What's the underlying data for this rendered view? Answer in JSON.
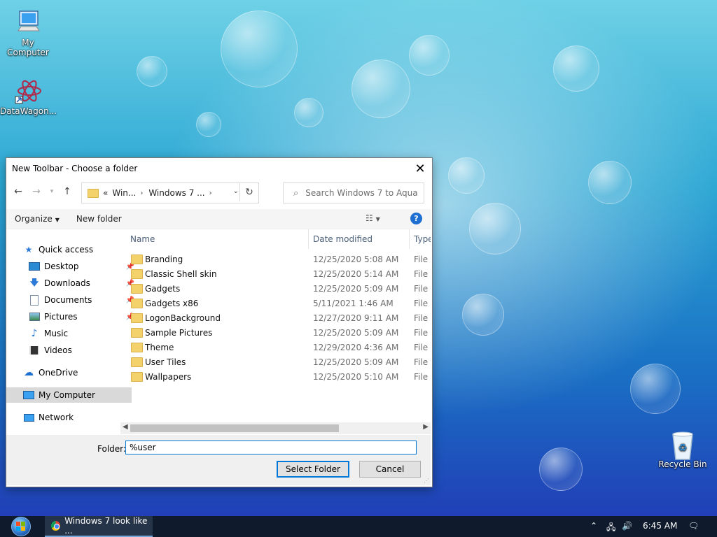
{
  "desktop": {
    "icons": [
      {
        "label": "My Computer"
      },
      {
        "label": "DataWagon..."
      },
      {
        "label": "Recycle Bin"
      }
    ]
  },
  "dialog": {
    "title": "New Toolbar - Choose a folder",
    "address": {
      "crumbs": [
        "«",
        "Win...",
        "Windows 7 ..."
      ]
    },
    "search_placeholder": "Search Windows 7 to Aqua",
    "commands": {
      "organize": "Organize",
      "new_folder": "New folder"
    },
    "nav": [
      {
        "label": "Quick access",
        "icon": "star-icon"
      },
      {
        "label": "Desktop",
        "icon": "desktop-icon",
        "pinned": true
      },
      {
        "label": "Downloads",
        "icon": "download-icon",
        "pinned": true
      },
      {
        "label": "Documents",
        "icon": "document-icon",
        "pinned": true
      },
      {
        "label": "Pictures",
        "icon": "pictures-icon",
        "pinned": true
      },
      {
        "label": "Music",
        "icon": "music-icon"
      },
      {
        "label": "Videos",
        "icon": "video-icon"
      },
      {
        "label": "OneDrive",
        "icon": "cloud-icon"
      },
      {
        "label": "My Computer",
        "icon": "computer-icon",
        "selected": true
      },
      {
        "label": "Network",
        "icon": "network-icon"
      }
    ],
    "columns": {
      "name": "Name",
      "date": "Date modified",
      "type": "Type"
    },
    "files": [
      {
        "name": "Branding",
        "date": "12/25/2020 5:08 AM",
        "type": "File fo"
      },
      {
        "name": "Classic Shell skin",
        "date": "12/25/2020 5:14 AM",
        "type": "File fo"
      },
      {
        "name": "Gadgets",
        "date": "12/25/2020 5:09 AM",
        "type": "File fo"
      },
      {
        "name": "Gadgets x86",
        "date": "5/11/2021 1:46 AM",
        "type": "File fo"
      },
      {
        "name": "LogonBackground",
        "date": "12/27/2020 9:11 AM",
        "type": "File fo"
      },
      {
        "name": "Sample Pictures",
        "date": "12/25/2020 5:09 AM",
        "type": "File fo"
      },
      {
        "name": "Theme",
        "date": "12/29/2020 4:36 AM",
        "type": "File fo"
      },
      {
        "name": "User Tiles",
        "date": "12/25/2020 5:09 AM",
        "type": "File fo"
      },
      {
        "name": "Wallpapers",
        "date": "12/25/2020 5:10 AM",
        "type": "File fo"
      }
    ],
    "folder_label": "Folder:",
    "folder_value": "%user",
    "select_button": "Select Folder",
    "cancel_button": "Cancel"
  },
  "taskbar": {
    "task_label": "Windows 7 look like ...",
    "clock": "6:45 AM"
  }
}
